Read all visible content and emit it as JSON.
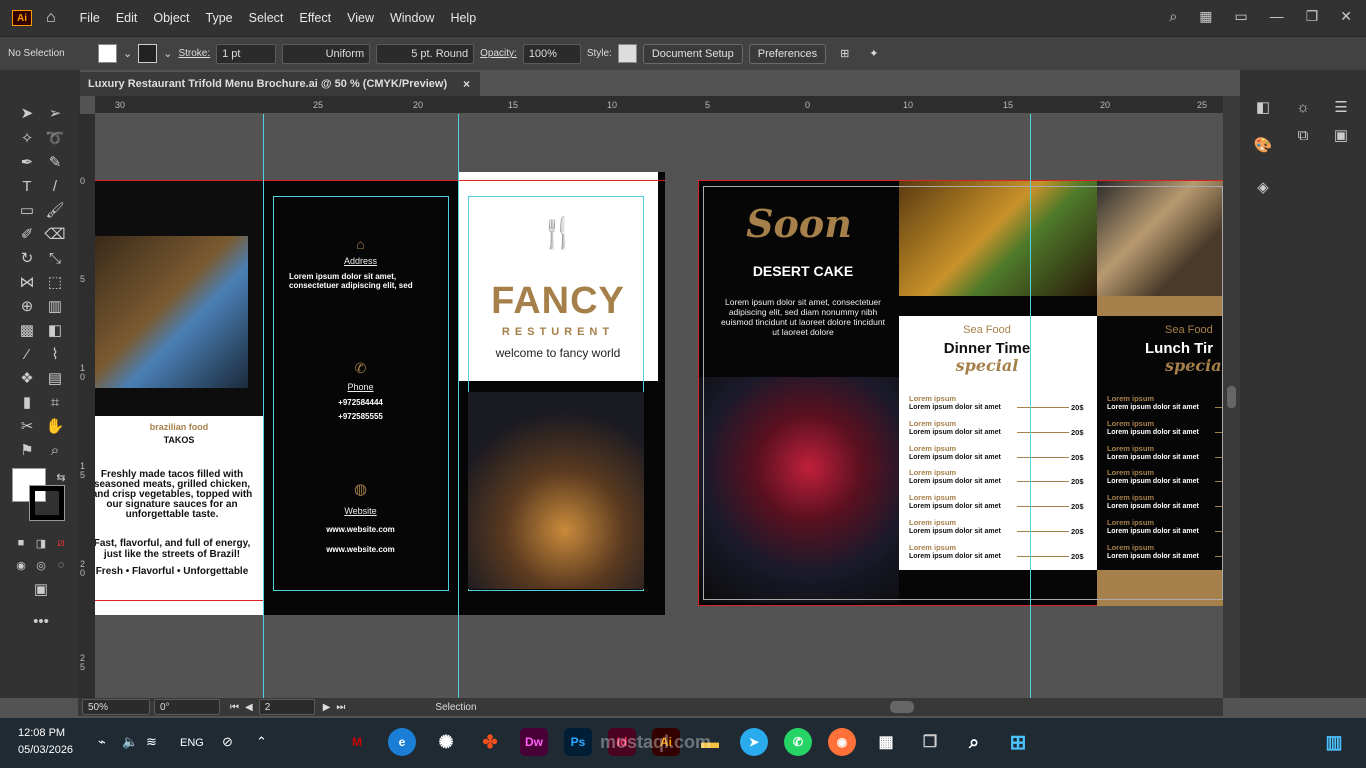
{
  "app": {
    "logo": "Ai",
    "menus": [
      "File",
      "Edit",
      "Object",
      "Type",
      "Select",
      "Effect",
      "View",
      "Window",
      "Help"
    ]
  },
  "control": {
    "selection": "No Selection",
    "stroke_label": "Stroke:",
    "stroke_value": "1 pt",
    "uniform": "Uniform",
    "brush": "5 pt. Round",
    "opacity_label": "Opacity:",
    "opacity_value": "100%",
    "style_label": "Style:",
    "doc_setup": "Document Setup",
    "preferences": "Preferences"
  },
  "tab": {
    "title": "Luxury Restaurant Trifold Menu Brochure.ai @ 50 % (CMYK/Preview)",
    "close": "×"
  },
  "hruler": [
    "30",
    "25",
    "20",
    "15",
    "10",
    "5",
    "0",
    "5",
    "10",
    "15",
    "20",
    "25"
  ],
  "vruler": [
    "0",
    "5",
    "1 0",
    "1 5",
    "2 0",
    "2 5"
  ],
  "page1": {
    "left": {
      "food_title": "brazilian food",
      "food_name": "TAKOS",
      "desc1": "Freshly made tacos filled with seasoned meats, grilled chicken, and crisp vegetables, topped with our signature sauces for an unforgettable taste.",
      "desc2": "Fast, flavorful, and full of energy, just like the streets of Brazil!",
      "tags": "Fresh • Flavorful • Unforgettable"
    },
    "mid": {
      "address_label": "Address",
      "address_text": "Lorem ipsum dolor sit amet, consectetuer adipiscing elit, sed",
      "phone_label": "Phone",
      "phone1": "+972584444",
      "phone2": "+972585555",
      "website_label": "Website",
      "web1": "www.website.com",
      "web2": "www.website.com"
    },
    "right": {
      "brand": "FANCY",
      "sub": "RESTURENT",
      "welcome": "welcome to fancy world"
    }
  },
  "page2": {
    "soon": {
      "script": "Soon",
      "title": "DESERT CAKE",
      "text": "Lorem ipsum dolor sit amet, consectetuer adipiscing elit, sed diam nonummy nibh euismod tincidunt ut laoreet dolore tincidunt ut laoreet dolore"
    },
    "dinner": {
      "kicker": "Sea Food",
      "title": "Dinner Time",
      "script": "special",
      "item_title": "Lorem ipsum",
      "item_text": "Lorem ipsum dolor sit amet",
      "price": "20$"
    },
    "lunch": {
      "kicker": "Sea Food",
      "title": "Lunch Tir",
      "script": "special",
      "item_title": "Lorem ipsum",
      "item_text": "Lorem ipsum dolor sit amet"
    }
  },
  "status": {
    "zoom": "50%",
    "angle": "0°",
    "artboard": "2",
    "mode": "Selection"
  },
  "taskbar": {
    "time": "12:08 PM",
    "date": "05/03/2026",
    "lang": "ENG",
    "watermark": "mostaql.com"
  },
  "colors": {
    "gold": "#a6804a",
    "guide": "#4ed2e0",
    "ai_orange": "#ff9a00"
  }
}
